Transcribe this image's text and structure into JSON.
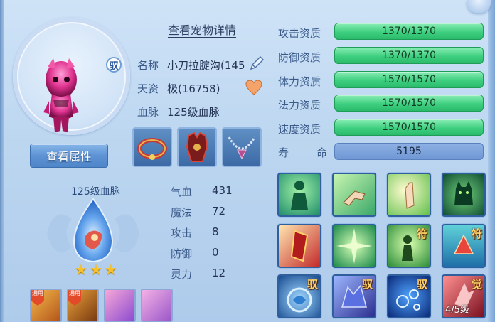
{
  "header": {
    "title_link": "查看宠物详情"
  },
  "pet": {
    "badge": "驭",
    "name_label": "名称",
    "name_value": "小刀拉腚沟(145",
    "talent_label": "天资",
    "talent_value": "极(16758)",
    "bloodline_label": "血脉",
    "bloodline_value": "125级血脉",
    "view_attributes_button": "查看属性"
  },
  "bloodline_orb": {
    "level_text": "125级血脉",
    "stars": 3
  },
  "stats": [
    {
      "label": "气血",
      "value": "431"
    },
    {
      "label": "魔法",
      "value": "72"
    },
    {
      "label": "攻击",
      "value": "8"
    },
    {
      "label": "防御",
      "value": "0"
    },
    {
      "label": "灵力",
      "value": "12"
    }
  ],
  "bottom_slots": [
    {
      "tag": "通用"
    },
    {
      "tag": "通用"
    },
    {
      "tag": ""
    },
    {
      "tag": ""
    }
  ],
  "aptitudes": [
    {
      "label": "攻击资质",
      "value": "1370/1370"
    },
    {
      "label": "防御资质",
      "value": "1370/1370"
    },
    {
      "label": "体力资质",
      "value": "1570/1570"
    },
    {
      "label": "法力资质",
      "value": "1570/1570"
    },
    {
      "label": "速度资质",
      "value": "1570/1570"
    }
  ],
  "life": {
    "label_a": "寿",
    "label_b": "命",
    "value": "5195"
  },
  "skills": [
    {
      "icon": "green-figure-skill-icon",
      "badge": "",
      "level": ""
    },
    {
      "icon": "hand-gesture-skill-icon",
      "badge": "",
      "level": ""
    },
    {
      "icon": "palm-light-skill-icon",
      "badge": "",
      "level": ""
    },
    {
      "icon": "green-cat-skill-icon",
      "badge": "",
      "level": ""
    },
    {
      "icon": "red-shield-skill-icon",
      "badge": "",
      "level": ""
    },
    {
      "icon": "green-burst-skill-icon",
      "badge": "",
      "level": ""
    },
    {
      "icon": "figure-glow-skill-icon",
      "badge": "符",
      "level": ""
    },
    {
      "icon": "red-crystal-skill-icon",
      "badge": "符",
      "level": ""
    },
    {
      "icon": "blue-beast-skill-icon",
      "badge": "驭",
      "level": ""
    },
    {
      "icon": "purple-wolf-skill-icon",
      "badge": "驭",
      "level": ""
    },
    {
      "icon": "blue-bubbles-skill-icon",
      "badge": "驭",
      "level": ""
    },
    {
      "icon": "red-shard-skill-icon",
      "badge": "觉",
      "level": "4/5级"
    }
  ]
}
